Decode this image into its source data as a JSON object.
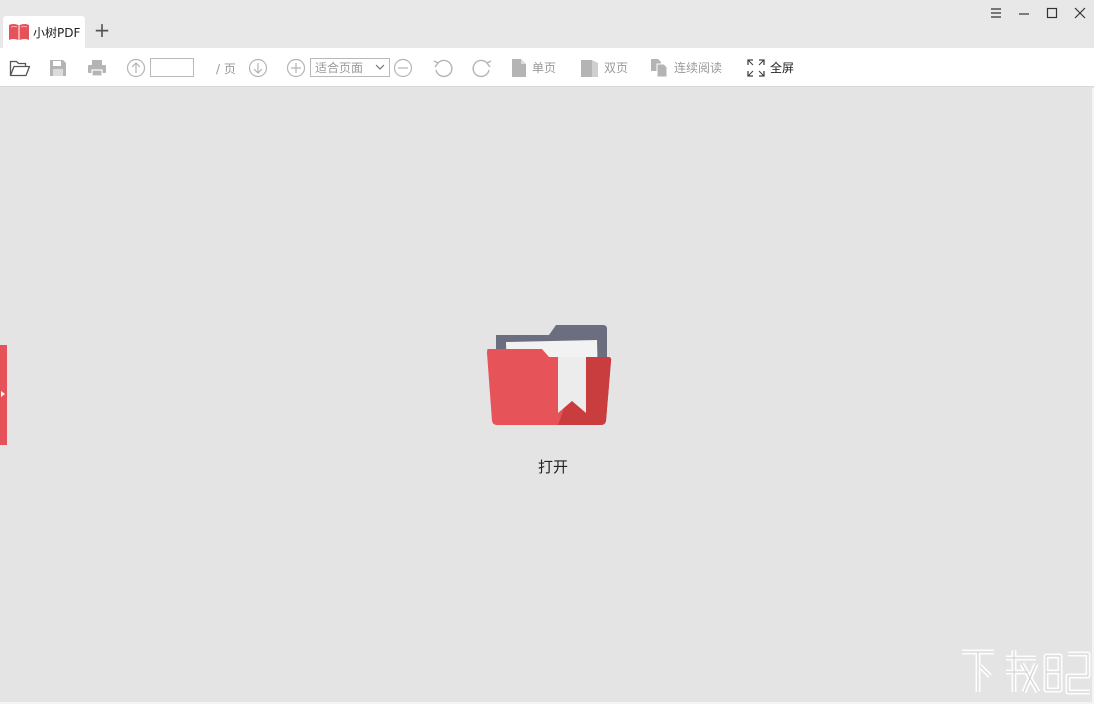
{
  "window": {
    "tab_title": "小树PDF",
    "new_tab_symbol": "+"
  },
  "toolbar": {
    "page_input_value": "",
    "page_suffix": "/ 页",
    "zoom_value": "适合页面",
    "single_page_label": "单页",
    "double_page_label": "双页",
    "continuous_label": "连续阅读",
    "fullscreen_label": "全屏"
  },
  "main": {
    "open_label": "打开"
  },
  "colors": {
    "brand_red": "#e5525a",
    "folder_red": "#e6545a",
    "folder_dark_red": "#c93d3f",
    "folder_back": "#6b6e7e",
    "icon_gray": "#b4b4b4"
  }
}
